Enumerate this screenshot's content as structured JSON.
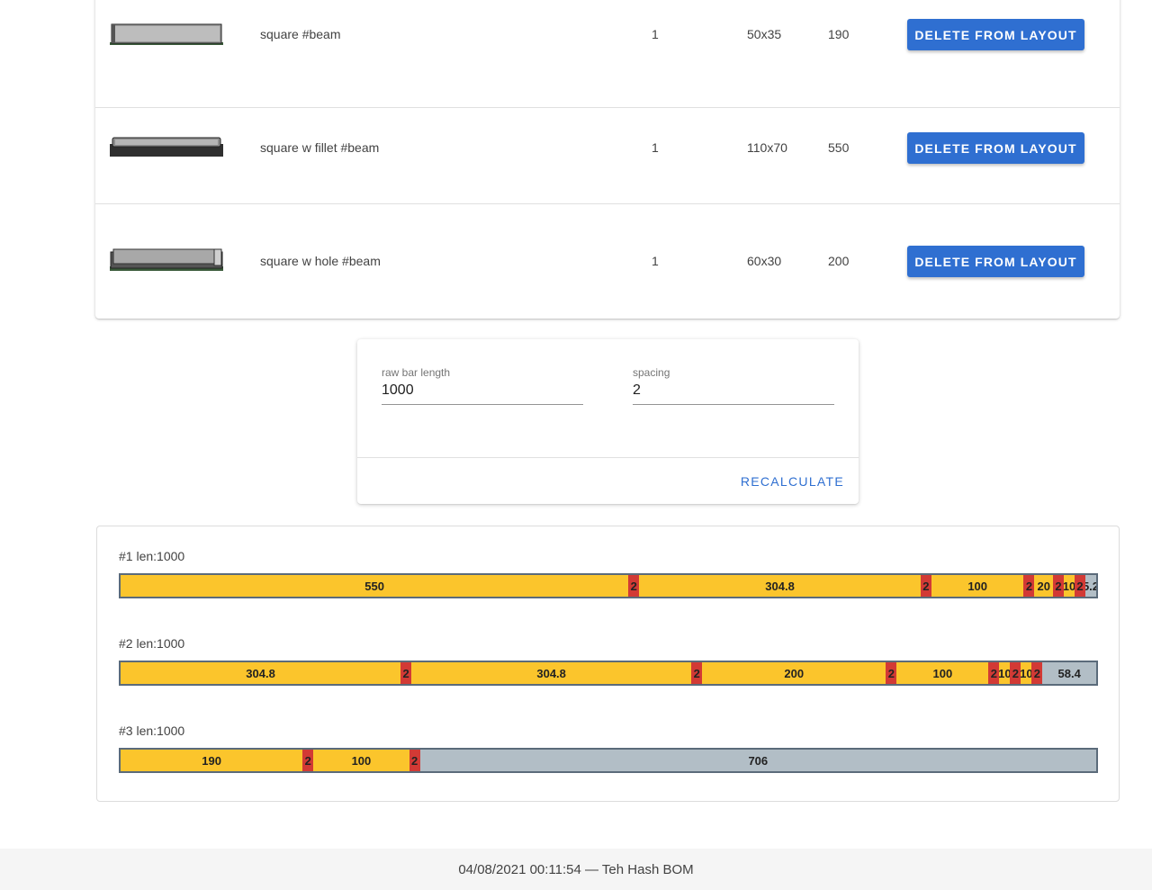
{
  "parts": [
    {
      "name": "square #beam",
      "qty": "1",
      "size": "50x35",
      "length": "190",
      "action": "DELETE FROM LAYOUT",
      "thumb_icon": "beam-square-icon"
    },
    {
      "name": "square w fillet #beam",
      "qty": "1",
      "size": "110x70",
      "length": "550",
      "action": "DELETE FROM LAYOUT",
      "thumb_icon": "beam-fillet-icon"
    },
    {
      "name": "square w hole #beam",
      "qty": "1",
      "size": "60x30",
      "length": "200",
      "action": "DELETE FROM LAYOUT",
      "thumb_icon": "beam-hole-icon"
    }
  ],
  "settings": {
    "raw_bar_length_label": "raw bar length",
    "raw_bar_length_value": "1000",
    "spacing_label": "spacing",
    "spacing_value": "2",
    "recalculate_label": "RECALCULATE"
  },
  "bars": [
    {
      "label": "#1 len:1000",
      "segments": [
        {
          "type": "part",
          "value": 550,
          "label": "550"
        },
        {
          "type": "gap",
          "value": 2,
          "label": "2"
        },
        {
          "type": "part",
          "value": 304.8,
          "label": "304.8"
        },
        {
          "type": "gap",
          "value": 2,
          "label": "2"
        },
        {
          "type": "part",
          "value": 100,
          "label": "100"
        },
        {
          "type": "gap",
          "value": 2,
          "label": "2"
        },
        {
          "type": "part",
          "value": 20,
          "label": "20"
        },
        {
          "type": "gap",
          "value": 2,
          "label": "2"
        },
        {
          "type": "part",
          "value": 10,
          "label": "10"
        },
        {
          "type": "gap",
          "value": 2,
          "label": "2"
        },
        {
          "type": "rest",
          "value": 5.2,
          "label": "5.2"
        }
      ]
    },
    {
      "label": "#2 len:1000",
      "segments": [
        {
          "type": "part",
          "value": 304.8,
          "label": "304.8"
        },
        {
          "type": "gap",
          "value": 2,
          "label": "2"
        },
        {
          "type": "part",
          "value": 304.8,
          "label": "304.8"
        },
        {
          "type": "gap",
          "value": 2,
          "label": "2"
        },
        {
          "type": "part",
          "value": 200,
          "label": "200"
        },
        {
          "type": "gap",
          "value": 2,
          "label": "2"
        },
        {
          "type": "part",
          "value": 100,
          "label": "100"
        },
        {
          "type": "gap",
          "value": 2,
          "label": "2"
        },
        {
          "type": "part",
          "value": 10,
          "label": "10"
        },
        {
          "type": "gap",
          "value": 2,
          "label": "2"
        },
        {
          "type": "part",
          "value": 10,
          "label": "10"
        },
        {
          "type": "gap",
          "value": 2,
          "label": "2"
        },
        {
          "type": "rest",
          "value": 58.4,
          "label": "58.4"
        }
      ]
    },
    {
      "label": "#3 len:1000",
      "segments": [
        {
          "type": "part",
          "value": 190,
          "label": "190"
        },
        {
          "type": "gap",
          "value": 2,
          "label": "2"
        },
        {
          "type": "part",
          "value": 100,
          "label": "100"
        },
        {
          "type": "gap",
          "value": 2,
          "label": "2"
        },
        {
          "type": "rest",
          "value": 706,
          "label": "706"
        }
      ]
    }
  ],
  "colors": {
    "part": "#fbc52c",
    "gap": "#d23a35",
    "rest": "#b2bec6",
    "accent": "#2f6fd1"
  },
  "footer": {
    "text": "04/08/2021 00:11:54 — Teh Hash BOM"
  }
}
